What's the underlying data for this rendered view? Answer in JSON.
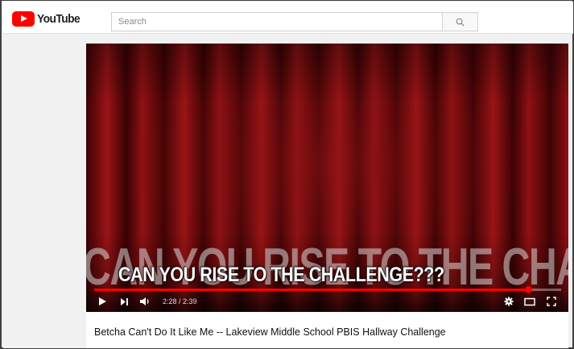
{
  "header": {
    "logo_text": "YouTube",
    "search_placeholder": "Search",
    "icons": {
      "logo": "youtube-play-logo",
      "search": "search-icon"
    }
  },
  "player": {
    "overlay_text_background": "CAN YOU RISE TO THE CHALLENGE???",
    "caption": "CAN YOU RISE TO THE CHALLENGE???",
    "current_time": "2:28",
    "duration": "2:39",
    "time_display": "2:28 / 2:39",
    "progress": 0.93,
    "colors": {
      "accent": "#ff0000",
      "curtain": "#7a0c0e"
    },
    "controls": [
      "play-icon",
      "next-icon",
      "volume-icon",
      "settings-icon",
      "theater-mode-icon",
      "fullscreen-icon"
    ]
  },
  "video": {
    "title": "Betcha Can't Do It Like Me -- Lakeview Middle School PBIS Hallway Challenge"
  }
}
